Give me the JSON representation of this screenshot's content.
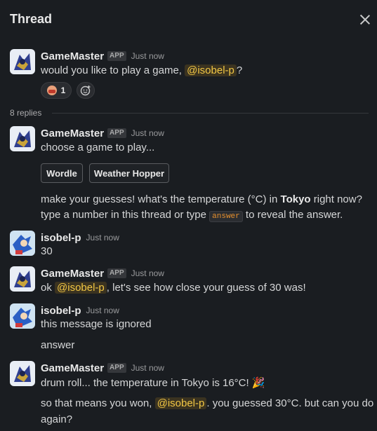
{
  "header": {
    "title": "Thread"
  },
  "parent": {
    "name": "GameMaster",
    "badge": "APP",
    "time": "Just now",
    "text_before": "would you like to play a game, ",
    "mention": "@isobel-p",
    "text_after": "?",
    "reaction_count": "1"
  },
  "replies_label": "8 replies",
  "replies": [
    {
      "name": "GameMaster",
      "badge": "APP",
      "time": "Just now",
      "line1": "choose a game to play...",
      "buttons": [
        "Wordle",
        "Weather Hopper"
      ],
      "line2_a": "make your guesses! what's the temperature (°C) in ",
      "line2_bold": "Tokyo",
      "line2_b": " right now?",
      "line3_a": "type a number in this thread or type ",
      "line3_code": "answer",
      "line3_b": " to reveal the answer."
    },
    {
      "name": "isobel-p",
      "time": "Just now",
      "line1": "30"
    },
    {
      "name": "GameMaster",
      "badge": "APP",
      "time": "Just now",
      "line1_a": "ok ",
      "mention": "@isobel-p",
      "line1_b": ", let's see how close your guess of 30 was!"
    },
    {
      "name": "isobel-p",
      "time": "Just now",
      "line1": "this message is ignored",
      "line2": "answer"
    },
    {
      "name": "GameMaster",
      "badge": "APP",
      "time": "Just now",
      "line1": "drum roll... the temperature in Tokyo is 16°C! 🎉",
      "line2_a": "so that means you won, ",
      "mention": "@isobel-p",
      "line2_b": ". you guessed 30°C. but can you do it",
      "line3": "again?"
    }
  ]
}
